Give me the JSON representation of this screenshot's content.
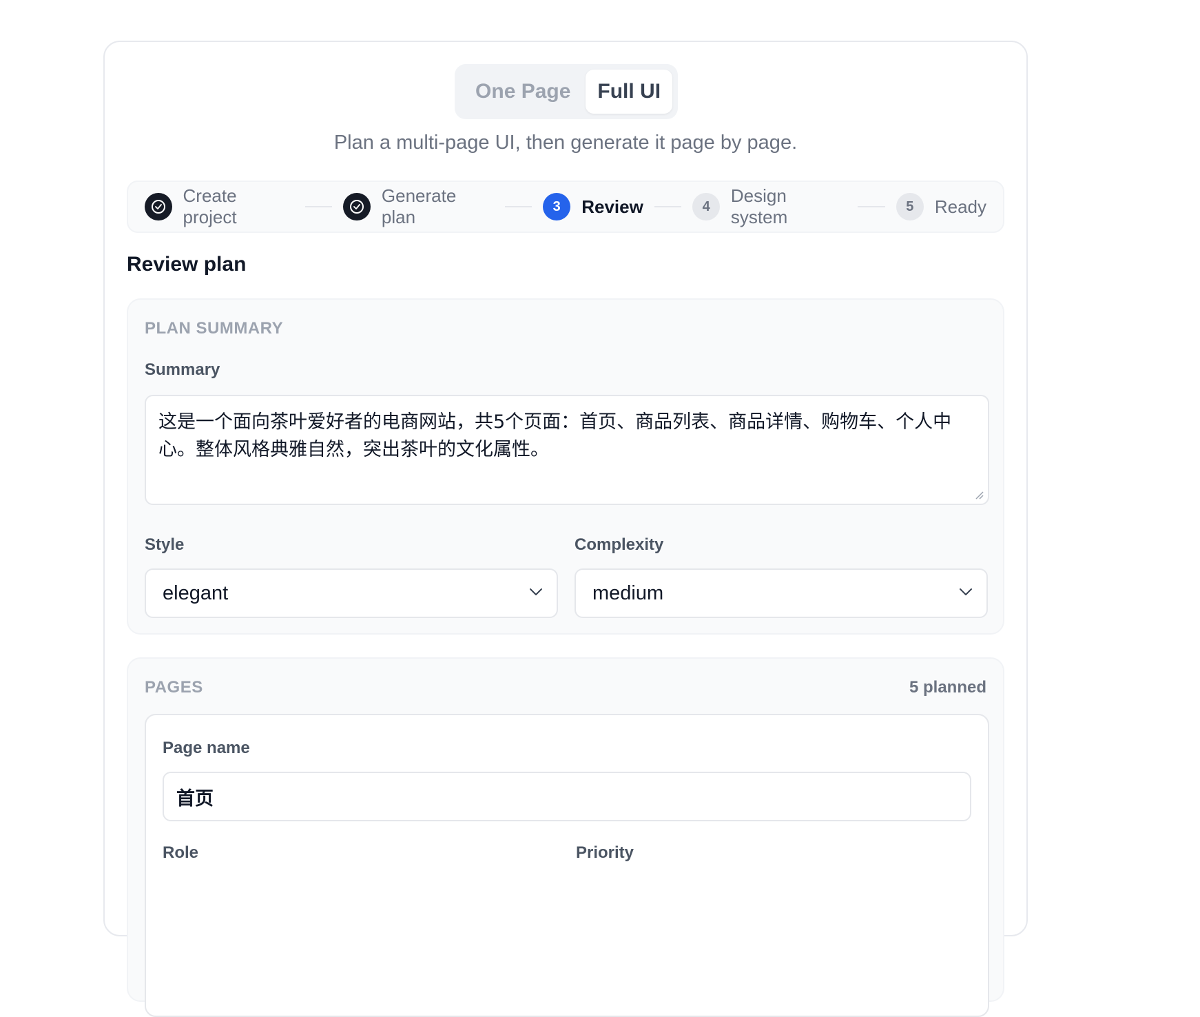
{
  "mode_toggle": {
    "one_page": "One Page",
    "full_ui": "Full UI"
  },
  "subtitle": "Plan a multi-page UI, then generate it page by page.",
  "stepper": {
    "steps": [
      {
        "label": "Create project",
        "state": "done",
        "number": ""
      },
      {
        "label": "Generate plan",
        "state": "done",
        "number": ""
      },
      {
        "label": "Review",
        "state": "active",
        "number": "3"
      },
      {
        "label": "Design system",
        "state": "todo",
        "number": "4"
      },
      {
        "label": "Ready",
        "state": "todo",
        "number": "5"
      }
    ]
  },
  "section_title": "Review plan",
  "plan_summary": {
    "heading": "PLAN SUMMARY",
    "summary_label": "Summary",
    "summary_value": "这是一个面向茶叶爱好者的电商网站，共5个页面：首页、商品列表、商品详情、购物车、个人中心。整体风格典雅自然，突出茶叶的文化属性。",
    "style_label": "Style",
    "style_value": "elegant",
    "complexity_label": "Complexity",
    "complexity_value": "medium"
  },
  "pages": {
    "heading": "PAGES",
    "count": "5 planned",
    "first_page": {
      "name_label": "Page name",
      "name_value": "首页",
      "role_label": "Role",
      "priority_label": "Priority"
    }
  },
  "colors": {
    "accent": "#2563eb",
    "done": "#161b26",
    "muted_text": "#6b7280",
    "panel_bg": "#f9fafb"
  }
}
